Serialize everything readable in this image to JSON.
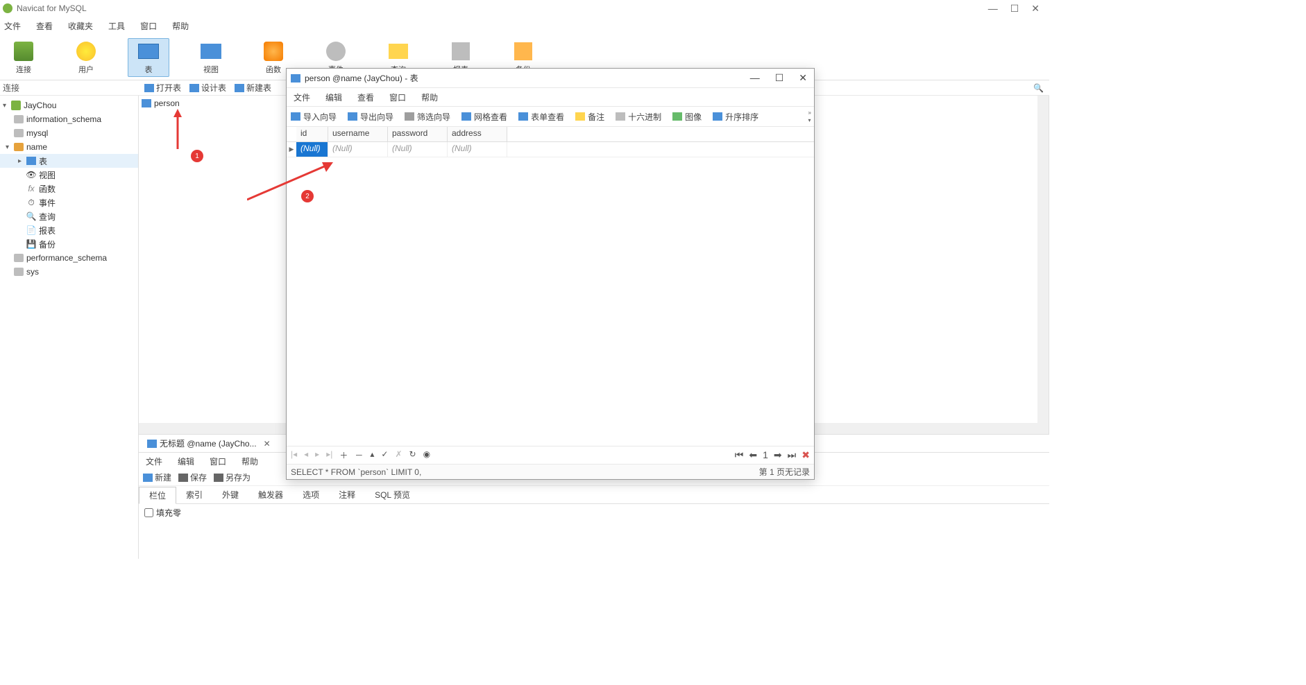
{
  "app": {
    "title": "Navicat for MySQL"
  },
  "main_menu": [
    "文件",
    "查看",
    "收藏夹",
    "工具",
    "窗口",
    "帮助"
  ],
  "main_toolbar": [
    {
      "label": "连接"
    },
    {
      "label": "用户"
    },
    {
      "label": "表",
      "selected": true
    },
    {
      "label": "视图"
    },
    {
      "label": "函数"
    },
    {
      "label": "事件"
    },
    {
      "label": "查询"
    },
    {
      "label": "报表"
    },
    {
      "label": "备份"
    }
  ],
  "sec_left": "连接",
  "sec_right": [
    "打开表",
    "设计表",
    "新建表"
  ],
  "tree": {
    "conn": "JayChou",
    "dbs": [
      "information_schema",
      "mysql"
    ],
    "open_db": "name",
    "tables_node": "表",
    "children": [
      "视图",
      "函数",
      "事件",
      "查询",
      "报表",
      "备份"
    ],
    "rest": [
      "performance_schema",
      "sys"
    ]
  },
  "obj_list": {
    "item": "person"
  },
  "bottom": {
    "tab_title": "无标题 @name (JayCho...",
    "menu": [
      "文件",
      "编辑",
      "窗口",
      "帮助"
    ],
    "tools": [
      "新建",
      "保存",
      "另存为"
    ],
    "design_tabs": [
      "栏位",
      "索引",
      "外键",
      "触发器",
      "选项",
      "注释",
      "SQL 预览"
    ],
    "checkbox": "填充零"
  },
  "subwin": {
    "title": "person @name (JayChou) - 表",
    "menu": [
      "文件",
      "编辑",
      "查看",
      "窗口",
      "帮助"
    ],
    "tools": [
      "导入向导",
      "导出向导",
      "筛选向导",
      "网格查看",
      "表单查看",
      "备注",
      "十六进制",
      "图像",
      "升序排序"
    ],
    "columns": [
      "id",
      "username",
      "password",
      "address"
    ],
    "row": {
      "id": "(Null)",
      "username": "(Null)",
      "password": "(Null)",
      "address": "(Null)"
    },
    "sql": "SELECT * FROM `person` LIMIT 0,",
    "status_right": "第 1 页无记录",
    "pager_page": "1"
  },
  "anno": {
    "m1": "1",
    "m2": "2"
  }
}
